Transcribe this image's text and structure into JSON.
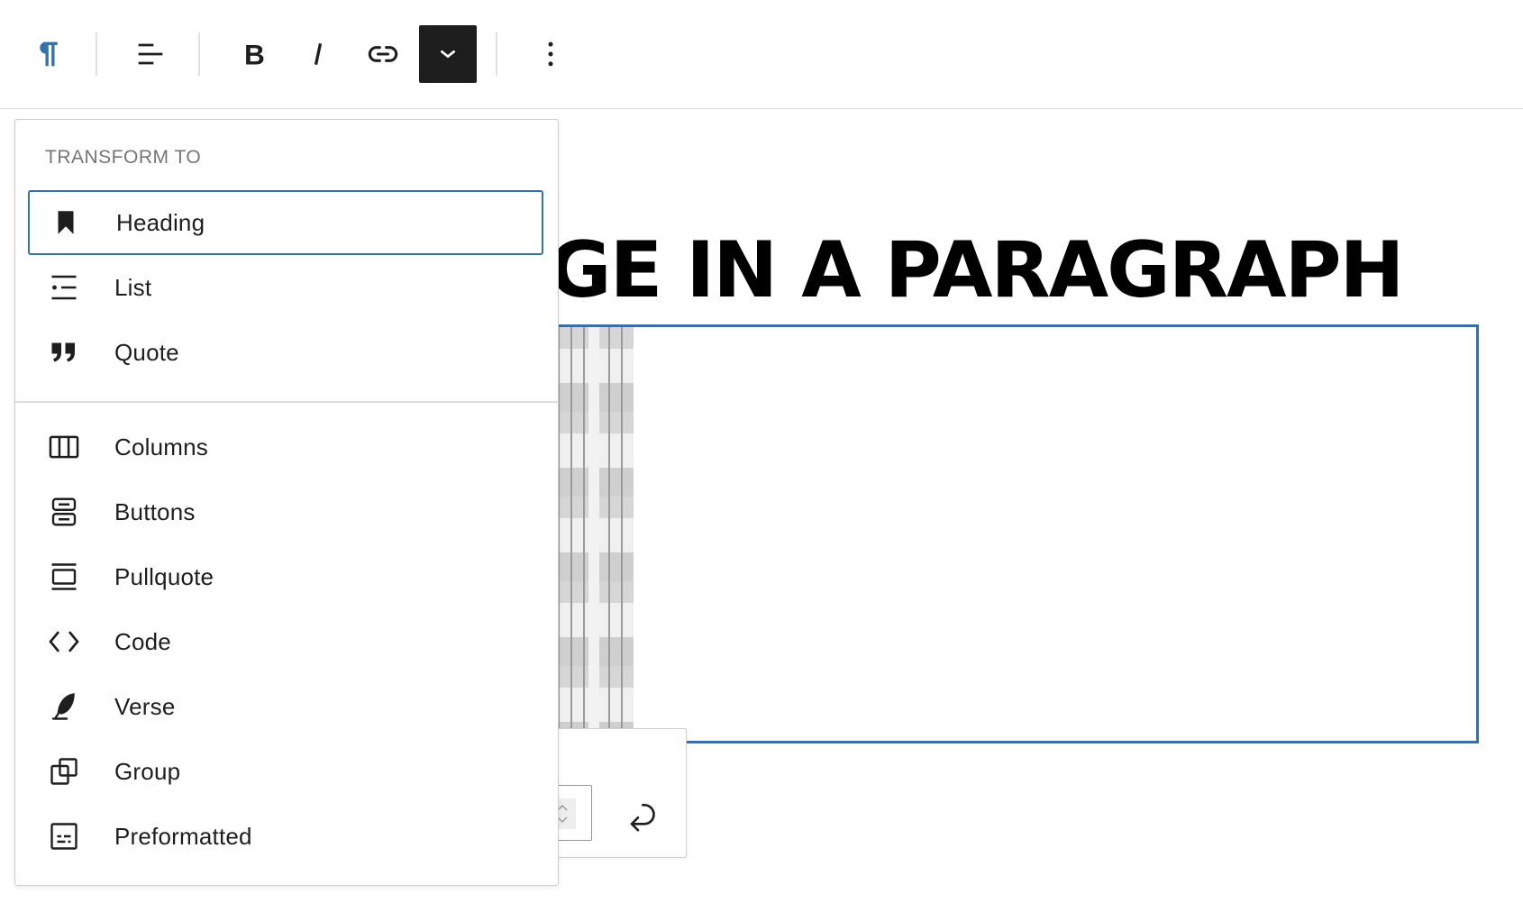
{
  "toolbar": {
    "buttons": [
      {
        "name": "paragraph-block-button",
        "icon": "pilcrow-icon"
      },
      {
        "name": "align-button",
        "icon": "align-left-icon"
      },
      {
        "name": "bold-button",
        "icon": "bold-icon"
      },
      {
        "name": "italic-button",
        "icon": "italic-icon"
      },
      {
        "name": "link-button",
        "icon": "link-icon"
      },
      {
        "name": "more-rich-text-controls-button",
        "icon": "chevron-down-icon",
        "active": true
      },
      {
        "name": "options-button",
        "icon": "more-vertical-icon"
      }
    ],
    "accent_color": "#3472aa"
  },
  "content": {
    "heading": "GE IN A PARAGRAPH"
  },
  "transform_menu": {
    "title": "TRANSFORM TO",
    "primary_items": [
      {
        "label": "Heading",
        "icon": "bookmark-icon",
        "selected": true
      },
      {
        "label": "List",
        "icon": "list-icon"
      },
      {
        "label": "Quote",
        "icon": "quote-icon"
      }
    ],
    "secondary_items": [
      {
        "label": "Columns",
        "icon": "columns-icon"
      },
      {
        "label": "Buttons",
        "icon": "buttons-icon"
      },
      {
        "label": "Pullquote",
        "icon": "pullquote-icon"
      },
      {
        "label": "Code",
        "icon": "code-icon"
      },
      {
        "label": "Verse",
        "icon": "feather-icon"
      },
      {
        "label": "Group",
        "icon": "group-icon"
      },
      {
        "label": "Preformatted",
        "icon": "preformatted-icon"
      }
    ]
  }
}
